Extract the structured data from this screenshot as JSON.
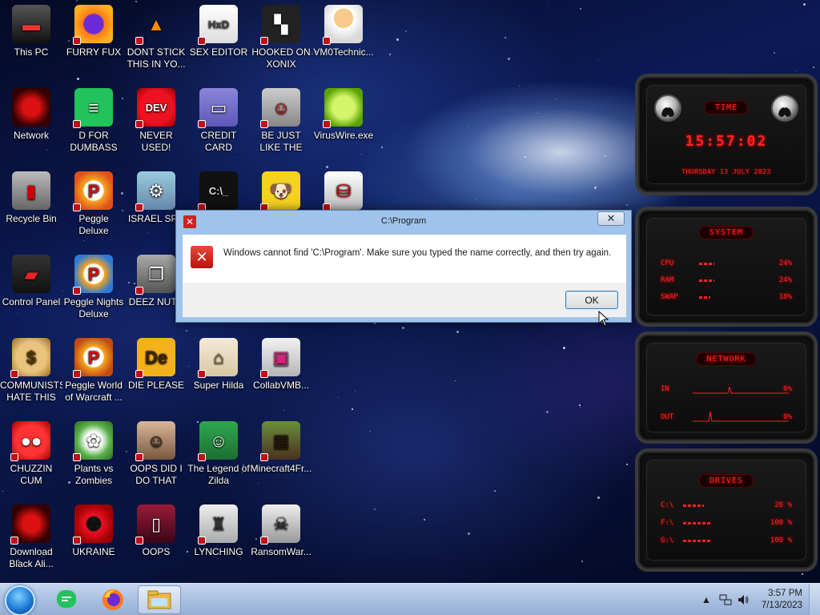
{
  "desktop_icons": [
    {
      "label": "This PC"
    },
    {
      "label": "FURRY FUX"
    },
    {
      "label": "DONT STICK THIS IN YO..."
    },
    {
      "label": "SEX EDITOR"
    },
    {
      "label": "HOOKED ON XONIX"
    },
    {
      "label": "VM0Technic..."
    },
    {
      "label": "Network"
    },
    {
      "label": "D FOR DUMBASS"
    },
    {
      "label": "NEVER USED!"
    },
    {
      "label": "CREDIT CARD CHECKER"
    },
    {
      "label": "BE JUST LIKE THE DUDE!"
    },
    {
      "label": "VirusWire.exe"
    },
    {
      "label": "Recycle Bin"
    },
    {
      "label": "Peggle Deluxe"
    },
    {
      "label": "ISRAEL SP..."
    },
    {
      "label": ""
    },
    {
      "label": ""
    },
    {
      "label": ""
    },
    {
      "label": "Control Panel"
    },
    {
      "label": "Peggle Nights Deluxe"
    },
    {
      "label": "DEEZ NUT..."
    },
    {
      "label": "COMMUNISTS HATE THIS G..."
    },
    {
      "label": "Peggle World of Warcraft ..."
    },
    {
      "label": "DIE PLEASE"
    },
    {
      "label": "Super Hilda"
    },
    {
      "label": "CollabVMB..."
    },
    {
      "label": "CHUZZIN CUM"
    },
    {
      "label": "Plants vs Zombies"
    },
    {
      "label": "OOPS DID I DO THAT"
    },
    {
      "label": "The Legend of Zilda"
    },
    {
      "label": "Minecraft4Fr..."
    },
    {
      "label": "Download Black Ali..."
    },
    {
      "label": "UKRAINE"
    },
    {
      "label": "OOPS"
    },
    {
      "label": "LYNCHING"
    },
    {
      "label": "RansomWar..."
    }
  ],
  "dialog": {
    "title": "C:\\Program",
    "close_glyph": "X",
    "message": "Windows cannot find 'C:\\Program'. Make sure you typed the name correctly, and then try again.",
    "ok_label": "OK"
  },
  "gadget": {
    "time_title": "TIME",
    "time_value": "15:57:02",
    "date_value": "THURSDAY 13 JULY 2023",
    "system_title": "SYSTEM",
    "system_rows": [
      {
        "key": "CPU",
        "value": "24%",
        "level": 0.24
      },
      {
        "key": "RAM",
        "value": "24%",
        "level": 0.24
      },
      {
        "key": "SWAP",
        "value": "18%",
        "level": 0.18
      }
    ],
    "network_title": "NETWORK",
    "network_rows": [
      {
        "key": "IN",
        "value": "0%"
      },
      {
        "key": "OUT",
        "value": "0%"
      }
    ],
    "drives_title": "DRIVES",
    "drive_rows": [
      {
        "key": "C:\\",
        "value": "26 %",
        "level": 0.26
      },
      {
        "key": "F:\\",
        "value": "100 %",
        "level": 1.0
      },
      {
        "key": "G:\\",
        "value": "100 %",
        "level": 1.0
      }
    ],
    "accent_color": "#ff2222"
  },
  "taskbar": {
    "clock_time": "3:57 PM",
    "clock_date": "7/13/2023",
    "pinned": [
      "start-orb",
      "green-chat-app",
      "firefox",
      "file-explorer"
    ]
  }
}
